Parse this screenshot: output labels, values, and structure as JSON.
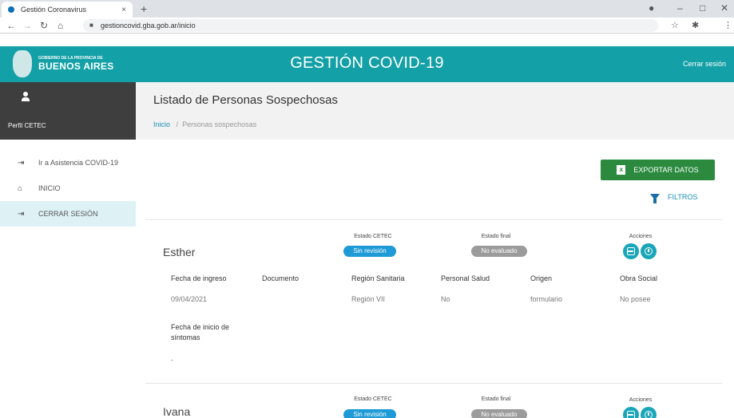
{
  "browser": {
    "tab_title": "Gestión Coronavirus",
    "tab_close": "×",
    "new_tab": "+",
    "url": "gestioncovid.gba.gob.ar/inicio"
  },
  "header": {
    "logo_small": "GOBIERNO DE LA PROVINCIA DE",
    "logo_big": "BUENOS AIRES",
    "title": "GESTIÓN COVID-19",
    "logout": "Cerrar sesión"
  },
  "sidebar": {
    "profile": "Perfil CETEC",
    "items": [
      {
        "label": "Ir a Asistencia COVID-19",
        "icon": "login-icon"
      },
      {
        "label": "INICIO",
        "icon": "home-icon"
      },
      {
        "label": "CERRAR SESIÓN",
        "icon": "logout-icon"
      }
    ]
  },
  "page": {
    "title": "Listado de Personas Sospechosas",
    "breadcrumb_home": "Inicio",
    "breadcrumb_sep": "/",
    "breadcrumb_current": "Personas sospechosas"
  },
  "actions": {
    "export": "EXPORTAR DATOS",
    "filters": "FILTROS"
  },
  "labels": {
    "estado_cetec": "Estado CETEC",
    "estado_final": "Estado final",
    "acciones": "Acciones",
    "fecha_ingreso": "Fecha de ingreso",
    "documento": "Documento",
    "region": "Región Sanitaria",
    "personal_salud": "Personal Salud",
    "origen": "Origen",
    "obra_social": "Obra Social",
    "fecha_sintomas": "Fecha de inicio de síntomas"
  },
  "records": [
    {
      "name": "Esther",
      "estado_cetec": "Sin revisión",
      "estado_final": "No evaluado",
      "fecha_ingreso": "09/04/2021",
      "documento": "",
      "region": "Región VII",
      "personal_salud": "No",
      "origen": "formulario",
      "obra_social": "No posee",
      "fecha_sintomas": "-"
    },
    {
      "name": "Ivana",
      "estado_cetec": "Sin revisión",
      "estado_final": "No evaluado"
    }
  ],
  "colors": {
    "header": "#13a0a6",
    "sidebar_dark": "#3e3e3e",
    "export": "#2b8a3e",
    "badge_blue": "#1e9ad6",
    "badge_grey": "#9b9b9b"
  }
}
